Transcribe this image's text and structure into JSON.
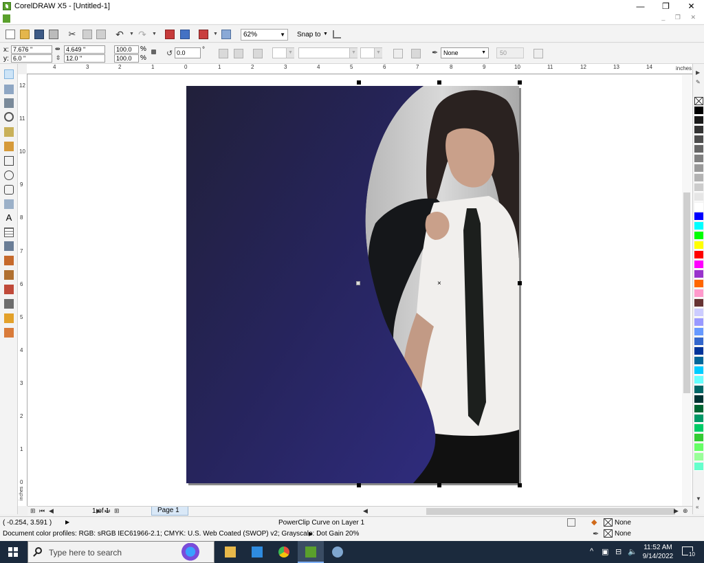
{
  "window": {
    "title": "CorelDRAW X5 - [Untitled-1]",
    "controls": {
      "minimize": "—",
      "restore": "❐",
      "close": "✕"
    }
  },
  "toolbar": {
    "zoom": "62%",
    "snap_to": "Snap to"
  },
  "property_bar": {
    "x_label": "x:",
    "x_value": "7.676 \"",
    "y_label": "y:",
    "y_value": "6.0 \"",
    "width_value": "4.649 \"",
    "height_value": "12.0 \"",
    "scale_w": "100.0",
    "scale_h": "100.0",
    "percent": "%",
    "rotation": "0.0",
    "degree": "°",
    "outline_width": "None",
    "wrap_value": "50"
  },
  "rulers": {
    "units": "inches",
    "h_ticks": [
      "4",
      "3",
      "2",
      "1",
      "0",
      "1",
      "2",
      "3",
      "4",
      "5",
      "6",
      "7",
      "8",
      "9",
      "10",
      "11",
      "12",
      "13",
      "14"
    ],
    "v_ticks": [
      "12",
      "11",
      "10",
      "9",
      "8",
      "7",
      "6",
      "5",
      "4",
      "3",
      "2",
      "1",
      "0"
    ]
  },
  "page_nav": {
    "count": "1 of 1",
    "tab": "Page 1"
  },
  "status": {
    "coords": "( -0.254, 3.591 )",
    "object_info": "PowerClip Curve on Layer 1",
    "color_profiles": "Document color profiles: RGB: sRGB IEC61966-2.1; CMYK: U.S. Web Coated (SWOP) v2; Grayscale: Dot Gain 20%",
    "fill_label": "None",
    "outline_label": "None"
  },
  "palette": {
    "colors": [
      "#000000",
      "#1a1a1a",
      "#333333",
      "#4d4d4d",
      "#666666",
      "#808080",
      "#999999",
      "#b3b3b3",
      "#cccccc",
      "#e6e6e6",
      "#ffffff",
      "#0000ff",
      "#00ffff",
      "#00ff00",
      "#ffff00",
      "#ff0000",
      "#ff00ff",
      "#9933cc",
      "#ff6600",
      "#ff99cc",
      "#663333",
      "#ccccff",
      "#9999ff",
      "#6699ff",
      "#3366cc",
      "#003399",
      "#006699",
      "#00ccff",
      "#66ffff",
      "#006666",
      "#003333",
      "#006633",
      "#009966",
      "#00cc66",
      "#33cc33",
      "#66ff66",
      "#99ff99",
      "#66ffcc"
    ]
  },
  "taskbar": {
    "search_placeholder": "Type here to search",
    "time": "11:52 AM",
    "date": "9/14/2022",
    "notification_count": "10"
  },
  "accent_colors": {
    "page_dark": "#201f3a",
    "page_navy": "#2d2a78",
    "corel_green": "#5aa02c"
  }
}
